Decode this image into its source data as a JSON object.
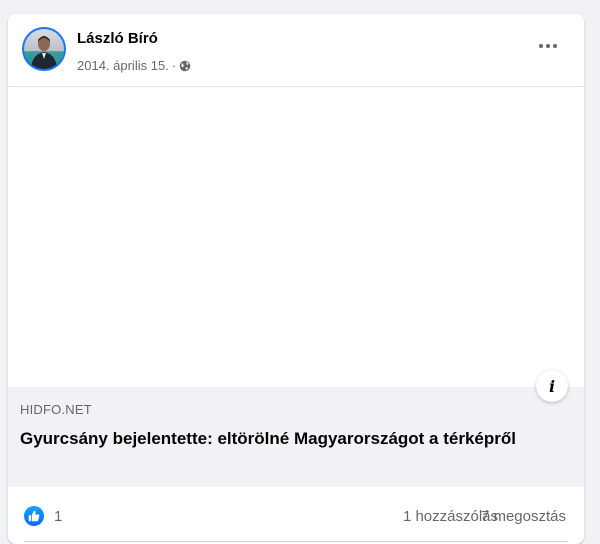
{
  "post": {
    "author": "László Bíró",
    "date": "2014. április 15.",
    "separator": "·",
    "privacy_icon": "globe-icon",
    "more_icon": "more-options-icon"
  },
  "link": {
    "domain": "HIDFO.NET",
    "title": "Gyurcsány bejelentette: eltörölné Magyarországot a térképről",
    "info_icon_label": "i"
  },
  "stats": {
    "reaction_icon": "like-icon",
    "reactions": "1",
    "comments": "1 hozzászólás",
    "shares": "7 megosztás"
  },
  "colors": {
    "accent": "#1877f2",
    "secondary_text": "#65676b",
    "link_box_bg": "#f0f2f5"
  }
}
